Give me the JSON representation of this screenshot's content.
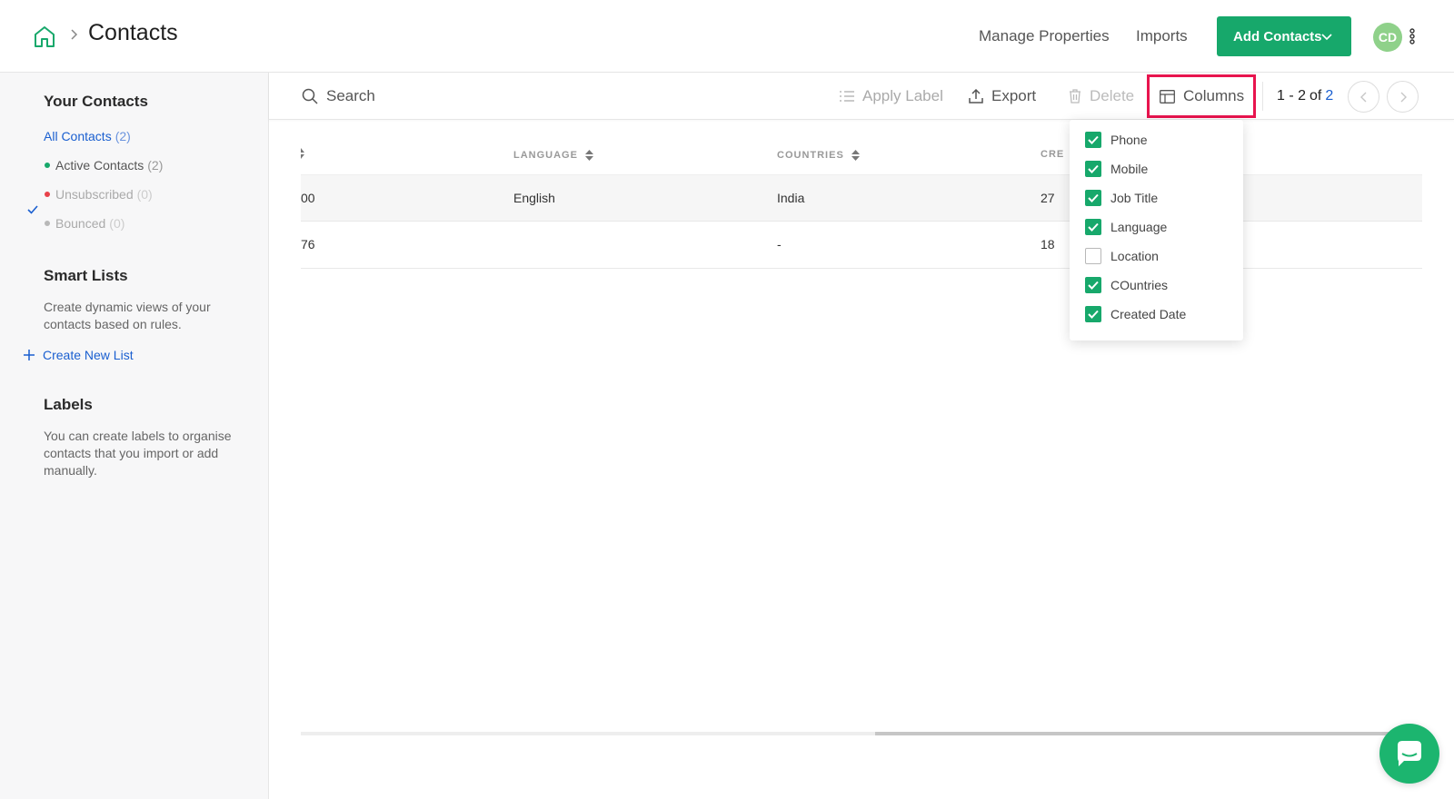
{
  "header": {
    "title": "Contacts",
    "manage_properties": "Manage Properties",
    "imports": "Imports",
    "add_contacts": "Add Contacts",
    "avatar_initials": "CD"
  },
  "sidebar": {
    "your_contacts_heading": "Your Contacts",
    "items": [
      {
        "label": "All Contacts",
        "count": "(2)",
        "selected": true
      },
      {
        "label": "Active Contacts",
        "count": "(2)",
        "dot_color": "#17a86b"
      },
      {
        "label": "Unsubscribed",
        "count": "(0)",
        "dot_color": "#e8414a"
      },
      {
        "label": "Bounced",
        "count": "(0)",
        "dot_color": "#b8b8b8"
      }
    ],
    "smart_lists_heading": "Smart Lists",
    "smart_lists_desc": "Create dynamic views of your contacts based on rules.",
    "create_new_list": "Create New List",
    "labels_heading": "Labels",
    "labels_desc": "You can create labels to organise contacts that you import or add manually."
  },
  "toolbar": {
    "search": "Search",
    "apply_label": "Apply Label",
    "export": "Export",
    "delete": "Delete",
    "columns": "Columns",
    "pager": {
      "range": "1 - 2",
      "of": "of",
      "total": "2"
    }
  },
  "table": {
    "headers": [
      "LANGUAGE",
      "COUNTRIES",
      "CRE"
    ],
    "rows": [
      {
        "partial": "00",
        "language": "English",
        "country": "India",
        "created": "27 "
      },
      {
        "partial": "76",
        "language": "",
        "country": "-",
        "created": "18 "
      }
    ]
  },
  "columns_menu": [
    {
      "label": "Phone",
      "checked": true
    },
    {
      "label": "Mobile",
      "checked": true
    },
    {
      "label": "Job Title",
      "checked": true
    },
    {
      "label": "Language",
      "checked": true
    },
    {
      "label": "Location",
      "checked": false
    },
    {
      "label": "COuntries",
      "checked": true
    },
    {
      "label": "Created Date",
      "checked": true
    }
  ],
  "colors": {
    "accent": "#17a86b",
    "link": "#1a5fd0",
    "highlight": "#e8144e"
  },
  "icons": [
    "home-icon",
    "chevron-right-icon",
    "chevron-down-icon",
    "more-vertical-icon",
    "search-icon",
    "list-icon",
    "upload-icon",
    "trash-icon",
    "table-columns-icon",
    "chevron-left-icon",
    "check-icon",
    "plus-icon",
    "sort-icon",
    "chat-icon"
  ]
}
